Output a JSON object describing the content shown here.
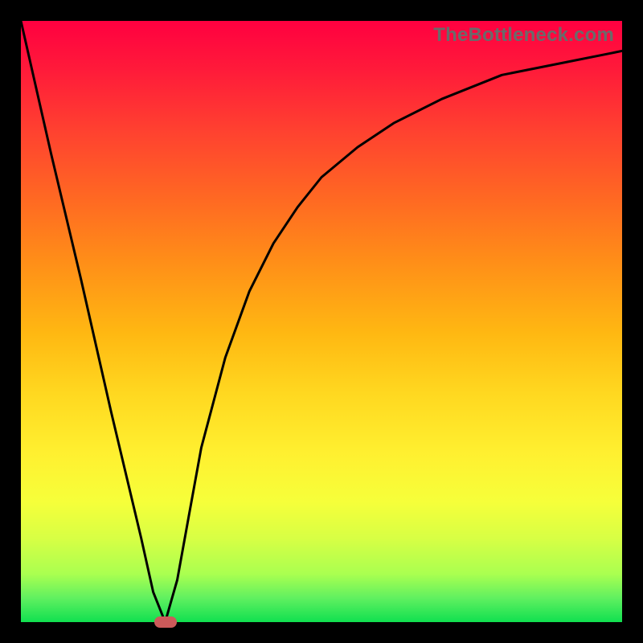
{
  "watermark": "TheBottleneck.com",
  "chart_data": {
    "type": "line",
    "title": "",
    "xlabel": "",
    "ylabel": "",
    "xlim": [
      0,
      100
    ],
    "ylim": [
      0,
      100
    ],
    "grid": false,
    "legend": false,
    "series": [
      {
        "name": "curve",
        "x": [
          0,
          5,
          10,
          15,
          20,
          22,
          24,
          26,
          28,
          30,
          34,
          38,
          42,
          46,
          50,
          56,
          62,
          70,
          80,
          90,
          100
        ],
        "y": [
          100,
          78,
          57,
          35,
          14,
          5,
          0,
          7,
          18,
          29,
          44,
          55,
          63,
          69,
          74,
          79,
          83,
          87,
          91,
          93,
          95
        ]
      }
    ],
    "marker": {
      "x": 24,
      "y": 0
    },
    "gradient_stops": [
      {
        "pos": 0,
        "color": "#ff0040"
      },
      {
        "pos": 50,
        "color": "#ffc018"
      },
      {
        "pos": 80,
        "color": "#f6ff3a"
      },
      {
        "pos": 100,
        "color": "#10e050"
      }
    ]
  }
}
